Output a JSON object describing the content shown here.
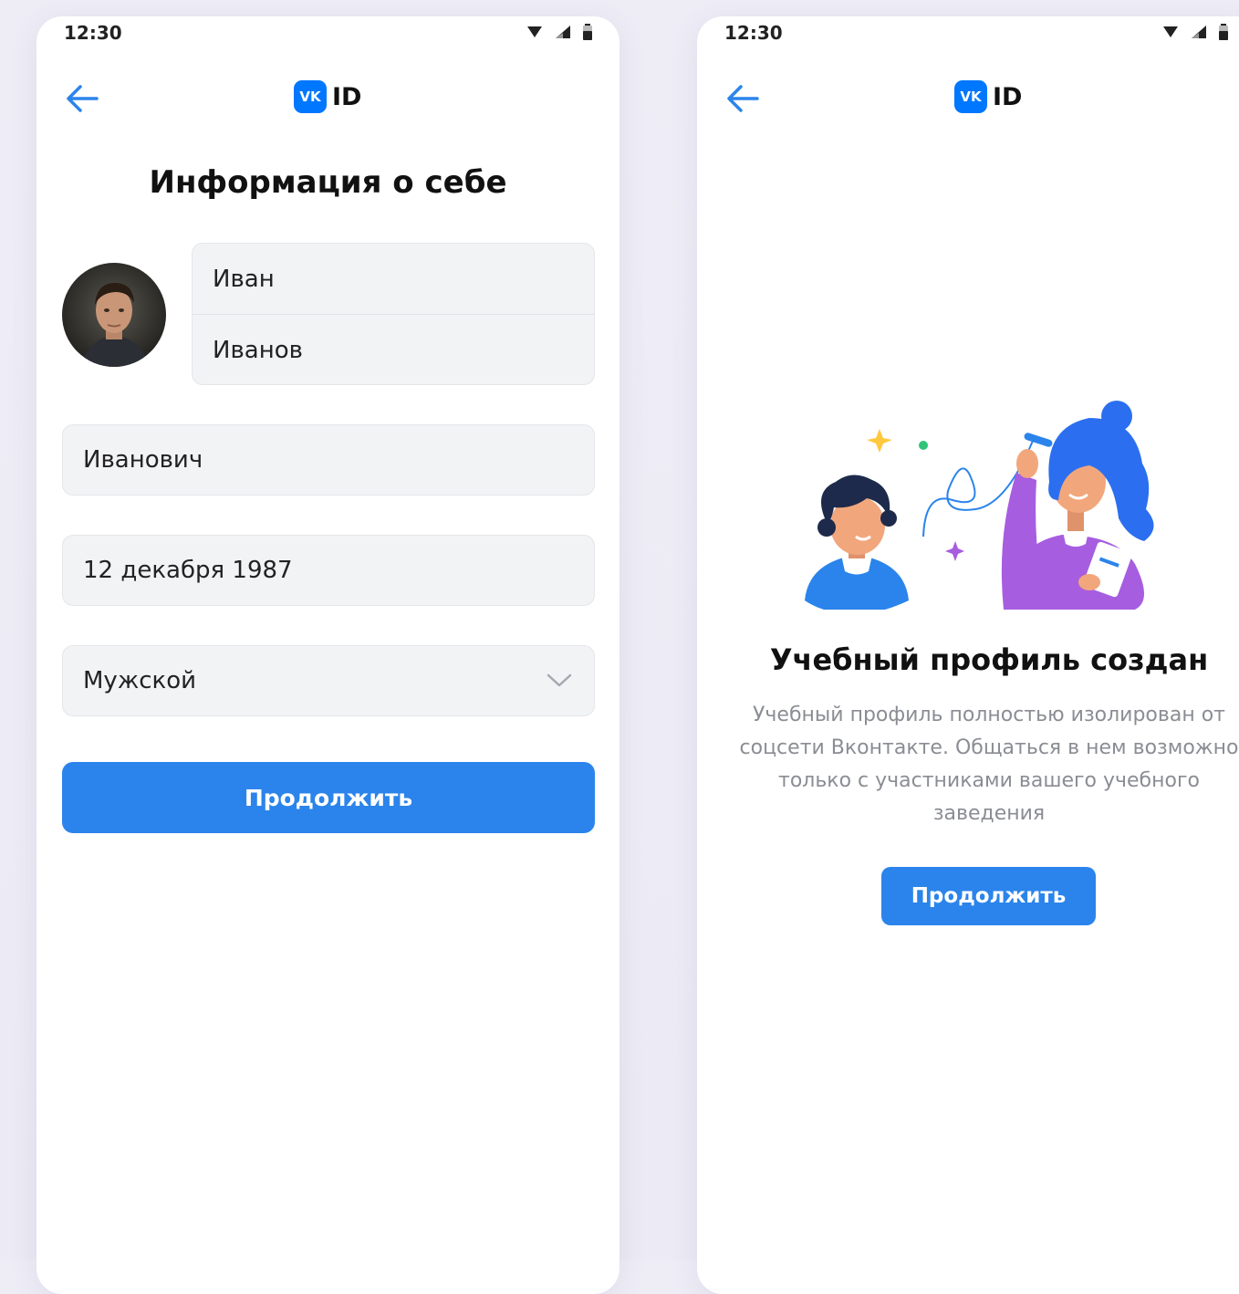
{
  "left_screen": {
    "status": {
      "time": "12:30"
    },
    "header": {
      "back_icon": "arrow-left-icon",
      "logo_badge": "VK",
      "logo_text": "ID"
    },
    "title": "Информация о себе",
    "avatar": {
      "icon": "user-photo"
    },
    "form": {
      "first_name": "Иван",
      "last_name": "Иванов",
      "patronymic": "Иванович",
      "birth_date": "12 декабря 1987",
      "gender": "Мужской",
      "gender_dropdown_icon": "chevron-down-icon"
    },
    "continue_label": "Продолжить"
  },
  "right_screen": {
    "status": {
      "time": "12:30"
    },
    "header": {
      "back_icon": "arrow-left-icon",
      "logo_badge": "VK",
      "logo_text": "ID"
    },
    "illustration": "teacher-and-student-illustration",
    "title": "Учебный профиль создан",
    "description": "Учебный профиль полностью изолирован от соцсети Вконтакте. Общаться в нем возможно только с участниками вашего учебного заведения",
    "continue_label": "Продолжить"
  },
  "colors": {
    "accent": "#2b84eb",
    "vk_blue": "#0077ff",
    "field_bg": "#f2f3f5",
    "muted_text": "#8a8d93"
  }
}
